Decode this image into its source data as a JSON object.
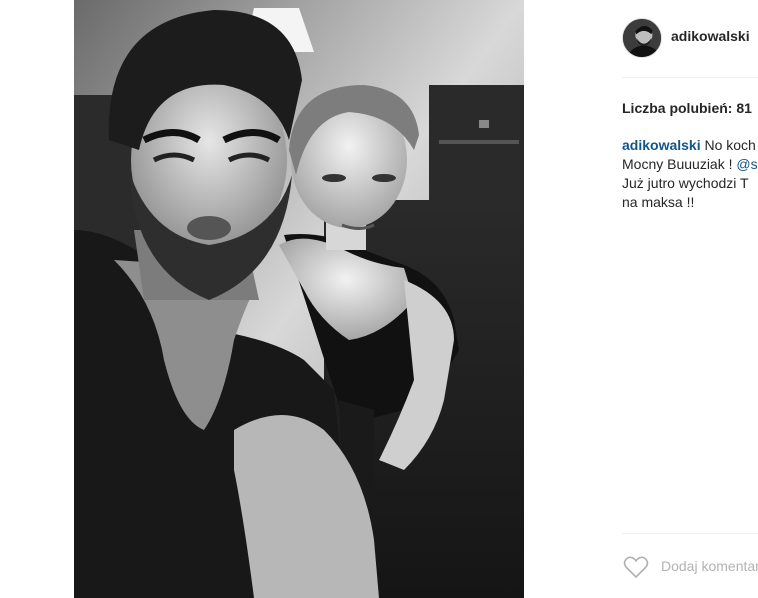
{
  "post": {
    "username": "adikowalski",
    "likes_text": "Liczba polubień: 81",
    "caption": {
      "username": "adikowalski",
      "line1_text": "No koch",
      "line2_text": "Mocny Buuuziak ! ",
      "line2_mention": "@s",
      "line3_text": "Już jutro wychodzi T",
      "line4_text": "na maksa !!"
    },
    "comment_placeholder": "Dodaj komentarz"
  },
  "icons": {
    "like": "heart-icon",
    "avatar": "profile-avatar"
  },
  "colors": {
    "username": "#262626",
    "link": "#125688",
    "placeholder": "#b3b3b3",
    "divider": "#efefef"
  }
}
